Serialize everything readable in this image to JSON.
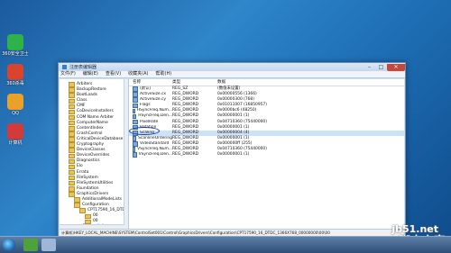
{
  "desktop_icons": [
    {
      "label": "360安全卫士",
      "color": "#2db34a"
    },
    {
      "label": "360杀毒",
      "color": "#d8442e"
    },
    {
      "label": "QQ",
      "color": "#e9a12a"
    },
    {
      "label": "计算机",
      "color": "#d33a3a"
    }
  ],
  "window": {
    "title": "注册表编辑器",
    "menu": [
      "文件(F)",
      "编辑(E)",
      "查看(V)",
      "收藏夹(A)",
      "帮助(H)"
    ],
    "tree": [
      "Arbiters",
      "BackupRestore",
      "BootLoads",
      "Class",
      "CMF",
      "CoDeviceInstallers",
      "COM Name Arbiter",
      "ComputerName",
      "ContentIndex",
      "CrashControl",
      "CriticalDeviceDatabase",
      "Cryptography",
      "DeviceClasses",
      "DeviceOverrides",
      "Diagnostics",
      "Elo",
      "Errata",
      "FileSystem",
      "FileSystemUtilities",
      "Foundation",
      "GraphicsDrivers",
      "AdditionalModeLists",
      "Configuration",
      "CPT17590_16_DTDC",
      "00",
      "00",
      "Connectivity"
    ],
    "columns": [
      "名称",
      "类型",
      "数据"
    ],
    "values": [
      {
        "name": "(默认)",
        "type": "REG_SZ",
        "data": "(数值未设置)"
      },
      {
        "name": "ActiveSize.cx",
        "type": "REG_DWORD",
        "data": "0x00000556 (1366)"
      },
      {
        "name": "ActiveSize.cy",
        "type": "REG_DWORD",
        "data": "0x00000300 (768)"
      },
      {
        "name": "Flags",
        "type": "REG_DWORD",
        "data": "0x01011007 (16850957)"
      },
      {
        "name": "HSyncFreq.Num...",
        "type": "REG_DWORD",
        "data": "0x0000bc6 (48250)"
      },
      {
        "name": "HSyncFreq.Den...",
        "type": "REG_DWORD",
        "data": "0x00000001 (1)"
      },
      {
        "name": "PixelRate",
        "type": "REG_DWORD",
        "data": "0x04710360 (75440000)"
      },
      {
        "name": "Rotation",
        "type": "REG_DWORD",
        "data": "0x00000001 (1)"
      },
      {
        "name": "Scaling",
        "type": "REG_DWORD",
        "data": "0x00000004 (4)"
      },
      {
        "name": "ScanlineOrdering",
        "type": "REG_DWORD",
        "data": "0x00000001 (1)"
      },
      {
        "name": "VideoStandard",
        "type": "REG_DWORD",
        "data": "0x000000ff (255)"
      },
      {
        "name": "VSyncFreq.Num...",
        "type": "REG_DWORD",
        "data": "0x04710360 (75440000)"
      },
      {
        "name": "VSyncFreq.Den...",
        "type": "REG_DWORD",
        "data": "0x00000001 (1)"
      }
    ],
    "status_path": "计算机\\HKEY_LOCAL_MACHINE\\SYSTEM\\ControlSet001\\Control\\GraphicsDrivers\\Configuration\\CPT17590_16_DTDC_1366X768_00000000\\00\\00"
  },
  "watermark": {
    "line1": "jb51.net",
    "line2": "脚本之家"
  }
}
